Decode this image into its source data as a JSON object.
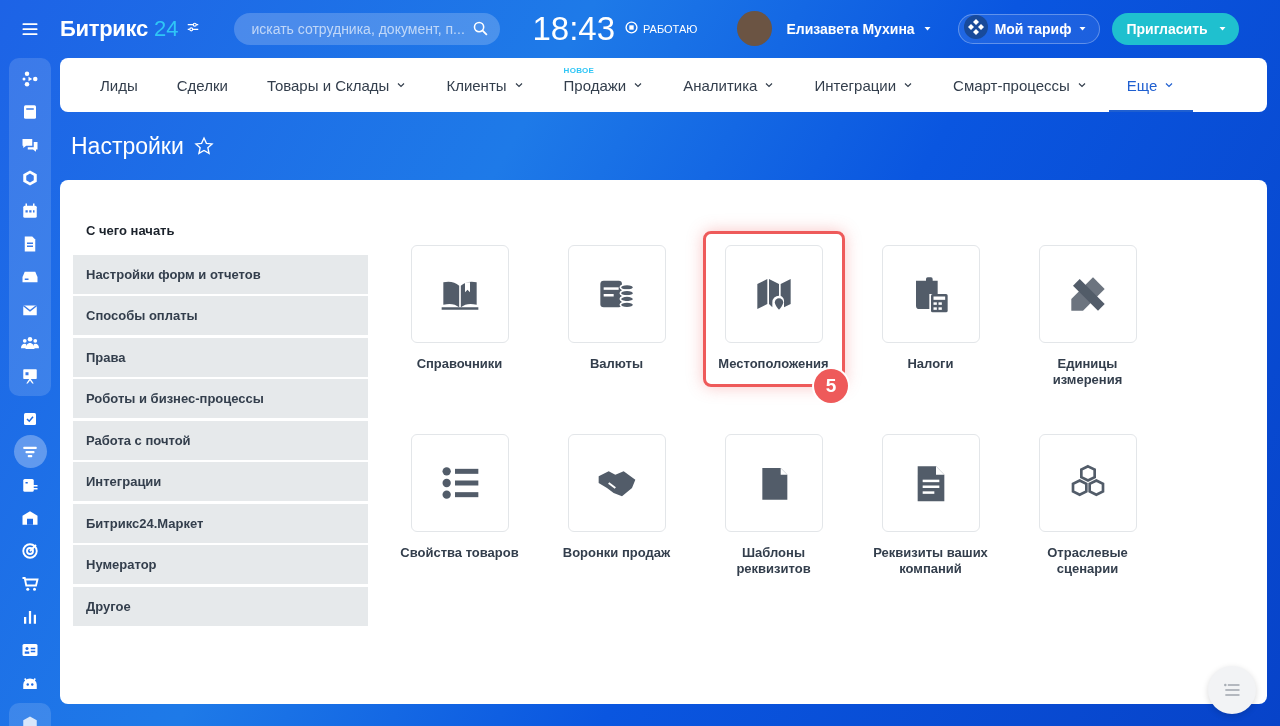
{
  "header": {
    "logo_text": "Битрикс",
    "logo_number": "24",
    "search": {
      "placeholder": "искать сотрудника, документ, п..."
    },
    "time": "18:43",
    "status": "РАБОТАЮ",
    "user_name": "Елизавета Мухина",
    "tariff_button": "Мой тариф",
    "invite_button": "Пригласить"
  },
  "sidebar": {
    "items": [
      {
        "kind": "play",
        "selected": false,
        "grouped": true
      },
      {
        "kind": "feed",
        "selected": false,
        "grouped": true
      },
      {
        "kind": "chat",
        "selected": false,
        "grouped": true
      },
      {
        "kind": "hexagon",
        "selected": false,
        "grouped": true
      },
      {
        "kind": "calendar",
        "selected": false,
        "grouped": true
      },
      {
        "kind": "document",
        "selected": false,
        "grouped": true
      },
      {
        "kind": "drive",
        "selected": false,
        "grouped": true
      },
      {
        "kind": "mail",
        "selected": false,
        "grouped": true
      },
      {
        "kind": "group",
        "selected": false,
        "grouped": true
      },
      {
        "kind": "board",
        "selected": false,
        "grouped": true
      },
      {
        "kind": "checkbox",
        "selected": false,
        "grouped": false
      },
      {
        "kind": "filter",
        "selected": true,
        "grouped": false
      },
      {
        "kind": "tasks",
        "selected": false,
        "grouped": false
      },
      {
        "kind": "building",
        "selected": false,
        "grouped": false
      },
      {
        "kind": "target",
        "selected": false,
        "grouped": false
      },
      {
        "kind": "cart",
        "selected": false,
        "grouped": false
      },
      {
        "kind": "chart",
        "selected": false,
        "grouped": false
      },
      {
        "kind": "card",
        "selected": false,
        "grouped": false
      },
      {
        "kind": "robot",
        "selected": false,
        "grouped": false
      },
      {
        "kind": "cube",
        "selected": false,
        "grouped": false
      }
    ]
  },
  "nav": [
    {
      "label": "Лиды",
      "dropdown": false,
      "selected": false
    },
    {
      "label": "Сделки",
      "dropdown": false,
      "selected": false
    },
    {
      "label": "Товары и Склады",
      "dropdown": true,
      "selected": false
    },
    {
      "label": "Клиенты",
      "dropdown": true,
      "selected": false
    },
    {
      "label": "Продажи",
      "dropdown": true,
      "selected": false,
      "badge": "НОВОЕ"
    },
    {
      "label": "Аналитика",
      "dropdown": true,
      "selected": false
    },
    {
      "label": "Интеграции",
      "dropdown": true,
      "selected": false
    },
    {
      "label": "Смарт-процессы",
      "dropdown": true,
      "selected": false
    },
    {
      "label": "Еще",
      "dropdown": true,
      "selected": true
    }
  ],
  "page_title": "Настройки",
  "settings_menu": {
    "heading": "С чего начать",
    "items": [
      "Настройки форм и отчетов",
      "Способы оплаты",
      "Права",
      "Роботы и бизнес-процессы",
      "Работа с почтой",
      "Интеграции",
      "Битрикс24.Маркет",
      "Нумератор",
      "Другое"
    ]
  },
  "tiles": [
    {
      "kind": "book",
      "label": "Справочники",
      "highlighted": false
    },
    {
      "kind": "coins",
      "label": "Валюты",
      "highlighted": false
    },
    {
      "kind": "map",
      "label": "Местоположения",
      "highlighted": true,
      "badge": "5"
    },
    {
      "kind": "calculator",
      "label": "Налоги",
      "highlighted": false
    },
    {
      "kind": "ruler",
      "label": "Единицы измерения",
      "highlighted": false
    },
    {
      "kind": "list",
      "label": "Свойства товаров",
      "highlighted": false
    },
    {
      "kind": "handshake",
      "label": "Воронки продаж",
      "highlighted": false
    },
    {
      "kind": "file",
      "label": "Шаблоны реквизитов",
      "highlighted": false
    },
    {
      "kind": "document",
      "label": "Реквизиты ваших компаний",
      "highlighted": false
    },
    {
      "kind": "cubes",
      "label": "Отраслевые сценарии",
      "highlighted": false
    }
  ]
}
